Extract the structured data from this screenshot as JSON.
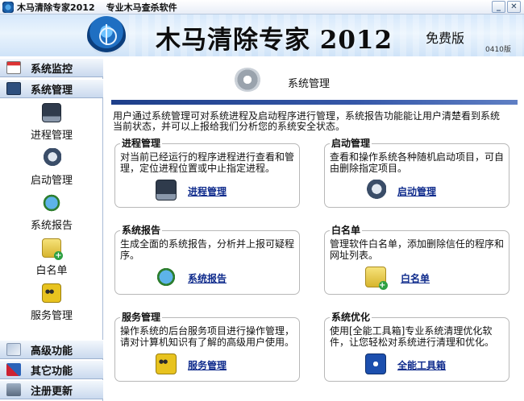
{
  "window": {
    "title": "木马清除专家2012",
    "subtitle": "专业木马查杀软件",
    "minimize_glyph": "_",
    "close_glyph": "✕"
  },
  "banner": {
    "title": "木马清除专家 2012",
    "badge": "免费版",
    "version": "0410版"
  },
  "sidebar": {
    "groups_top": [
      {
        "label": "系统监控",
        "icon": "monitor-icon"
      },
      {
        "label": "系统管理",
        "icon": "system-manage-icon"
      }
    ],
    "items": [
      {
        "label": "进程管理",
        "icon": "process-icon"
      },
      {
        "label": "启动管理",
        "icon": "startup-icon"
      },
      {
        "label": "系统报告",
        "icon": "report-icon"
      },
      {
        "label": "白名单",
        "icon": "whitelist-icon"
      },
      {
        "label": "服务管理",
        "icon": "service-icon"
      }
    ],
    "groups_bottom": [
      {
        "label": "高级功能",
        "icon": "advanced-icon"
      },
      {
        "label": "其它功能",
        "icon": "other-tools-icon"
      },
      {
        "label": "注册更新",
        "icon": "register-icon"
      }
    ]
  },
  "main": {
    "section_title": "系统管理",
    "intro": "用户通过系统管理可对系统进程及启动程序进行管理，系统报告功能能让用户清楚看到系统当前状态，并可以上报给我们分析您的系统安全状态。",
    "cards": [
      {
        "title": "进程管理",
        "desc": "对当前已经运行的程序进程进行查看和管理，定位进程位置或中止指定进程。",
        "link": "进程管理",
        "icon": "process-icon"
      },
      {
        "title": "启动管理",
        "desc": "查看和操作系统各种随机启动项目，可自由删除指定项目。",
        "link": "启动管理",
        "icon": "startup-icon"
      },
      {
        "title": "系统报告",
        "desc": "生成全面的系统报告，分析并上报可疑程序。",
        "link": "系统报告",
        "icon": "report-icon"
      },
      {
        "title": "白名单",
        "desc": "管理软件白名单，添加删除信任的程序和网址列表。",
        "link": "白名单",
        "icon": "whitelist-icon"
      },
      {
        "title": "服务管理",
        "desc": "操作系统的后台服务项目进行操作管理，请对计算机知识有了解的高级用户使用。",
        "link": "服务管理",
        "icon": "service-icon"
      },
      {
        "title": "系统优化",
        "desc": "使用[全能工具箱]专业系统清理优化软件，让您轻松对系统进行清理和优化。",
        "link": "全能工具箱",
        "icon": "toolbox-icon"
      }
    ]
  }
}
